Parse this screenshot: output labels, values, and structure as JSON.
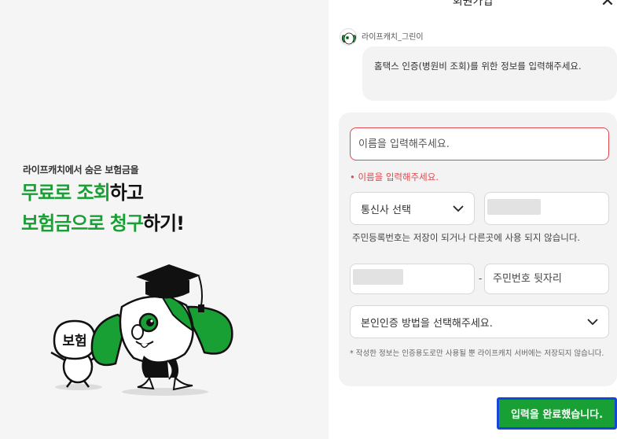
{
  "promo": {
    "tagline": "라이프캐치에서 숨은 보험금을",
    "headline_line1_green": "무료로 조회",
    "headline_line1_dark": "하고",
    "headline_line2_green": "보험금으로 청구",
    "headline_line2_dark": "하기!",
    "illustration_sign": "보험",
    "accent_color": "#19a034"
  },
  "modal": {
    "title": "회원가입",
    "close_icon": "close-icon",
    "bot": {
      "name": "라이프캐치_그린이",
      "message": "홈택스 인증(병원비 조회)를 위한 정보를 입력해주세요."
    },
    "form": {
      "name_placeholder": "이름을 입력해주세요.",
      "name_error": "• 이름을 입력해주세요.",
      "carrier_label": "통신사 선택",
      "notice": "주민등록번호는 저장이 되거나 다른곳에 사용 되지 않습니다.",
      "rrn_dash": "-",
      "rrn_back_placeholder": "주민번호 뒷자리",
      "auth_method_label": "본인인증 방법을 선택해주세요.",
      "footnote": "* 작성한 정보는 인증용도로만 사용될 뿐 라이프캐치 서버에는 저장되지 않습니다.",
      "error_color": "#e0484d"
    },
    "submit_label": "입력을 완료했습니다."
  }
}
